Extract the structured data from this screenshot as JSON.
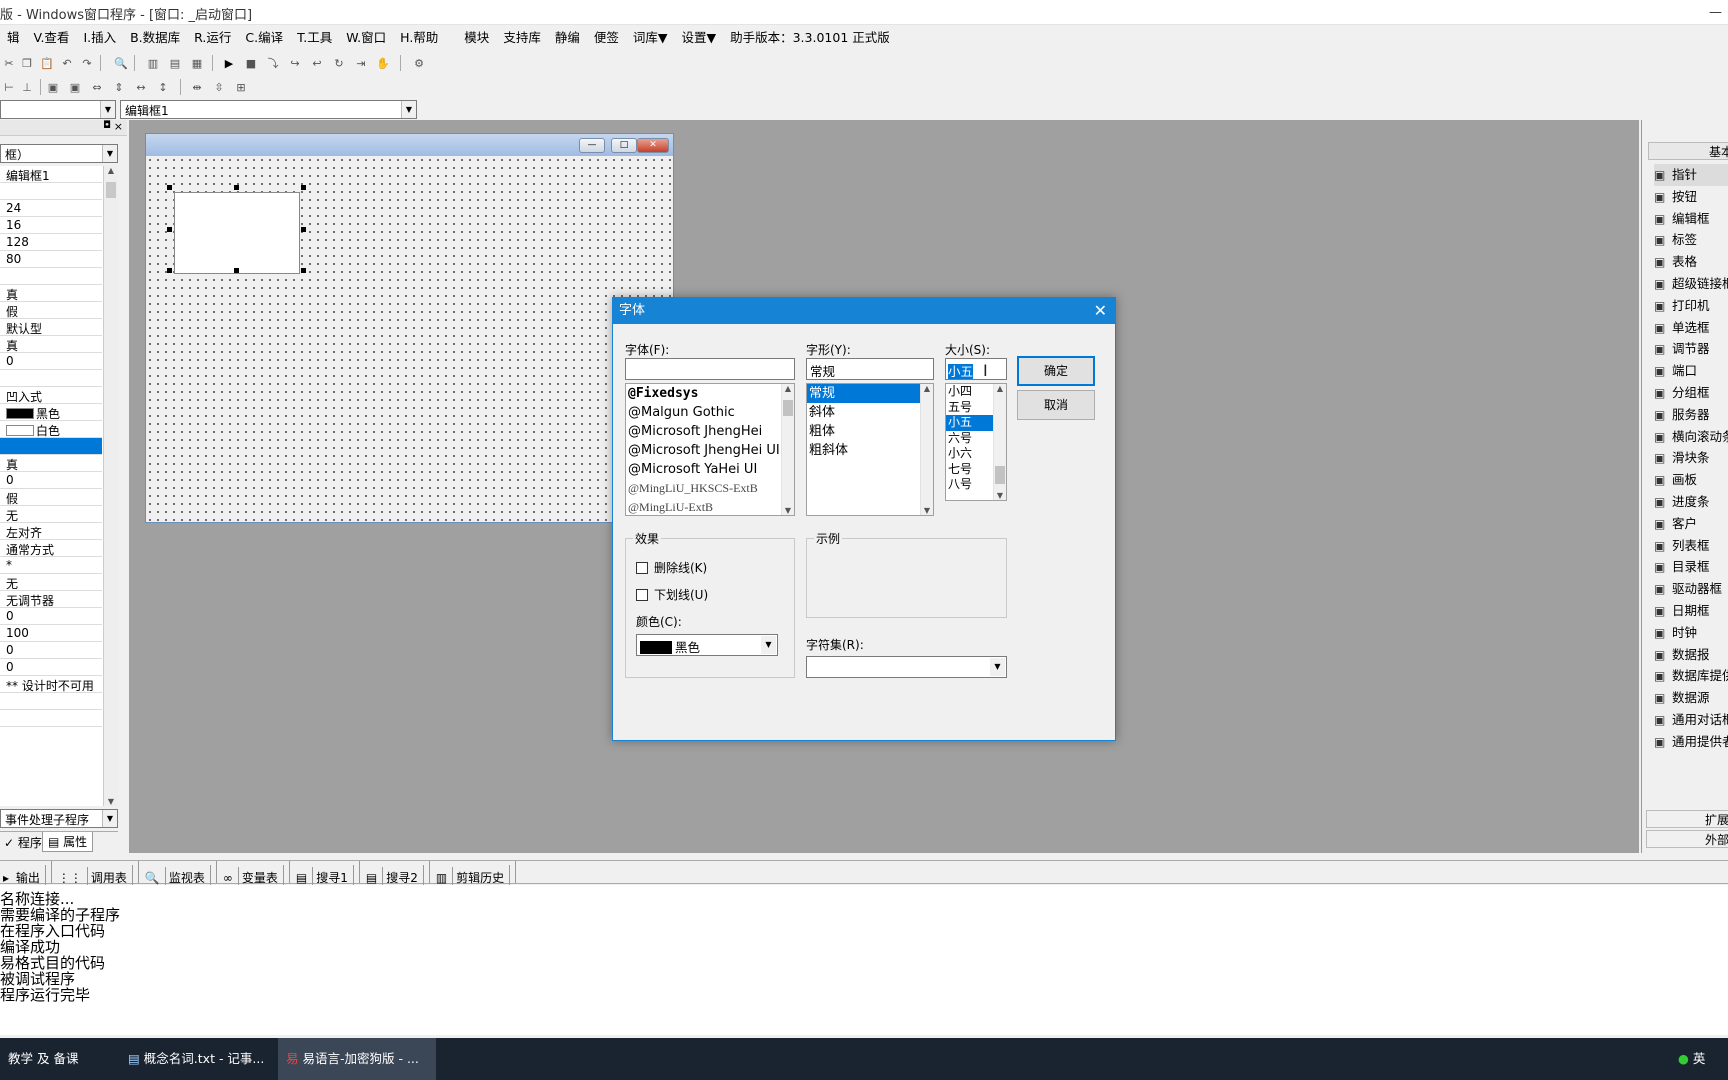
{
  "window": {
    "title": "版 - Windows窗口程序 - [窗口: _启动窗口]"
  },
  "menu": [
    "辑",
    "V.查看",
    "I.插入",
    "B.数据库",
    "R.运行",
    "C.编译",
    "T.工具",
    "W.窗口",
    "H.帮助",
    "模块",
    "支持库",
    "静编",
    "便签",
    "词库▼",
    "设置▼",
    "助手版本：3.3.0101 正式版"
  ],
  "combos": {
    "left": "",
    "right": "编辑框1"
  },
  "left_panel": {
    "object_combo": "框）",
    "props": [
      "编辑框1",
      "",
      "24",
      "16",
      "128",
      "80",
      "",
      "真",
      "假",
      "默认型",
      "真",
      "0",
      "",
      "凹入式",
      "黑色",
      "白色",
      "",
      "真",
      "0",
      "假",
      "无",
      "左对齐",
      "通常方式",
      "*",
      "无",
      "无调节器",
      "0",
      "100",
      "0",
      "0",
      "** 设计时不可用",
      "",
      ""
    ],
    "event_combo": "事件处理子程序",
    "tabs": [
      "程序",
      "属性"
    ]
  },
  "designer": {
    "window_buttons": [
      "—",
      "□",
      "✕"
    ]
  },
  "font_dialog": {
    "title": "字体",
    "font_label": "字体(F):",
    "font_value": "",
    "fonts": [
      "@Fixedsys",
      "@Malgun Gothic",
      "@Microsoft JhengHei",
      "@Microsoft JhengHei UI",
      "@Microsoft YaHei UI",
      "@MingLiU_HKSCS-ExtB",
      "@MingLiU-ExtB"
    ],
    "style_label": "字形(Y):",
    "style_value": "常规",
    "styles": [
      "常规",
      "斜体",
      "粗体",
      "粗斜体"
    ],
    "style_selected": 0,
    "size_label": "大小(S):",
    "size_value": "小五",
    "sizes": [
      "小四",
      "五号",
      "小五",
      "六号",
      "小六",
      "七号",
      "八号"
    ],
    "size_selected": 2,
    "ok": "确定",
    "cancel": "取消",
    "effects_label": "效果",
    "strikeout": "删除线(K)",
    "underline": "下划线(U)",
    "color_label": "颜色(C):",
    "color_value": "黑色",
    "sample_label": "示例",
    "charset_label": "字符集(R):",
    "charset_value": ""
  },
  "components": {
    "header": "基本",
    "items": [
      {
        "label": "指针",
        "icon": "pointer-icon"
      },
      {
        "label": "按钮",
        "icon": "button-icon"
      },
      {
        "label": "编辑框",
        "icon": "editbox-icon"
      },
      {
        "label": "标签",
        "icon": "label-icon"
      },
      {
        "label": "表格",
        "icon": "table-icon"
      },
      {
        "label": "超级链接框",
        "icon": "hyperlink-icon"
      },
      {
        "label": "打印机",
        "icon": "printer-icon"
      },
      {
        "label": "单选框",
        "icon": "radio-icon"
      },
      {
        "label": "调节器",
        "icon": "spinner-icon"
      },
      {
        "label": "端口",
        "icon": "port-icon"
      },
      {
        "label": "分组框",
        "icon": "groupbox-icon"
      },
      {
        "label": "服务器",
        "icon": "server-icon"
      },
      {
        "label": "横向滚动条",
        "icon": "hscroll-icon"
      },
      {
        "label": "滑块条",
        "icon": "slider-icon"
      },
      {
        "label": "画板",
        "icon": "canvas-icon"
      },
      {
        "label": "进度条",
        "icon": "progress-icon"
      },
      {
        "label": "客户",
        "icon": "client-icon"
      },
      {
        "label": "列表框",
        "icon": "listbox-icon"
      },
      {
        "label": "目录框",
        "icon": "dirbox-icon"
      },
      {
        "label": "驱动器框",
        "icon": "drive-icon"
      },
      {
        "label": "日期框",
        "icon": "date-icon"
      },
      {
        "label": "时钟",
        "icon": "clock-icon"
      },
      {
        "label": "数据报",
        "icon": "datagram-icon"
      },
      {
        "label": "数据库提供者",
        "icon": "dbprovider-icon"
      },
      {
        "label": "数据源",
        "icon": "datasource-icon"
      },
      {
        "label": "通用对话框",
        "icon": "dialog-icon"
      },
      {
        "label": "通用提供者",
        "icon": "provider-icon"
      }
    ],
    "footer1": "扩展",
    "footer2": "外部"
  },
  "bottom_tabs": [
    "输出",
    "调用表",
    "监视表",
    "变量表",
    "搜寻1",
    "搜寻2",
    "剪辑历史"
  ],
  "output_lines": [
    "名称连接...",
    "需要编译的子程序",
    "在程序入口代码",
    "编译成功",
    "易格式目的代码",
    "被调试程序",
    "程序运行完毕"
  ],
  "taskbar": [
    "教学 及 备课",
    "概念名词.txt - 记事...",
    "易语言-加密狗版 - ...",
    "英"
  ]
}
